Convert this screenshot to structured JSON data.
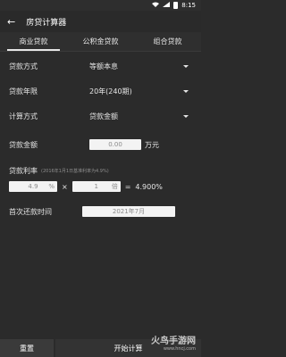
{
  "status": {
    "time": "8:15"
  },
  "appbar": {
    "title": "房贷计算器",
    "back_icon": "arrow-left-icon"
  },
  "tabs": [
    {
      "label": "商业贷款",
      "active": true
    },
    {
      "label": "公积金贷款",
      "active": false
    },
    {
      "label": "组合贷款",
      "active": false
    }
  ],
  "form": {
    "loan_method": {
      "label": "贷款方式",
      "value": "等额本息"
    },
    "loan_years": {
      "label": "贷款年限",
      "value": "20年(240期)"
    },
    "calc_method": {
      "label": "计算方式",
      "value": "贷款金额"
    },
    "loan_amount": {
      "label": "贷款金额",
      "value": "0.00",
      "unit": "万元"
    },
    "rate": {
      "label": "贷款利率",
      "note": "(2016年1月1日基准利率为4.9%)",
      "base": "4.9",
      "base_unit": "%",
      "times": "×",
      "multiplier": "1",
      "multiplier_unit": "倍",
      "equals": "=",
      "result": "4.900%"
    },
    "first_payment": {
      "label": "首次还款时间",
      "value": "2021年7月"
    }
  },
  "actions": {
    "reset": "重置",
    "calculate": "开始计算"
  },
  "watermark": {
    "text": "火鸟手游网",
    "url": "www.hncj.com"
  }
}
